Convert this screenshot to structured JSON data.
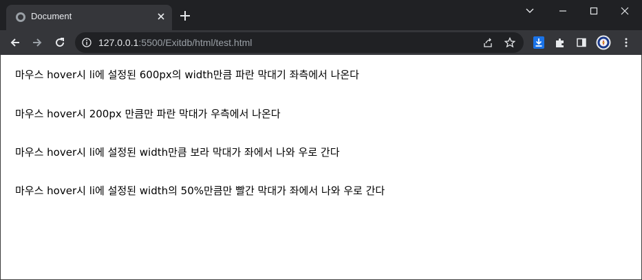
{
  "tab": {
    "title": "Document"
  },
  "address_bar": {
    "host": "127.0.0.1",
    "rest": ":5500/Exitdb/html/test.html"
  },
  "content": {
    "lines": [
      "마우스 hover시 li에 설정된 600px의 width만큼 파란 막대기 좌측에서 나온다",
      "마우스 hover시 200px 만큼만 파란 막대가 우측에서 나온다",
      "마우스 hover시 li에 설정된 width만큼 보라 막대가 좌에서 나와 우로 간다",
      "마우스 hover시 li에 설정된 width의 50%만큼만 빨간 막대가 좌에서 나와 우로 간다"
    ]
  },
  "icons": {
    "tab_favicon": "globe-icon",
    "tab_close": "close-icon",
    "new_tab": "plus-icon",
    "tab_search": "chevron-down-icon",
    "minimize": "minimize-icon",
    "maximize": "maximize-icon",
    "close_window": "close-icon",
    "back": "back-arrow-icon",
    "forward": "forward-arrow-icon",
    "reload": "reload-icon",
    "site_info": "info-icon",
    "share": "share-icon",
    "bookmark": "star-icon",
    "download_ext": "download-icon",
    "extensions": "puzzle-icon",
    "side_panel": "side-panel-icon",
    "profile": "avatar",
    "menu": "kebab-menu-icon"
  },
  "colors": {
    "frame": "#202124",
    "toolbar": "#35363a",
    "omnibox": "#202124",
    "text_light": "#e8eaed",
    "text_dim": "#9aa0a6",
    "download_badge": "#1a73e8"
  }
}
